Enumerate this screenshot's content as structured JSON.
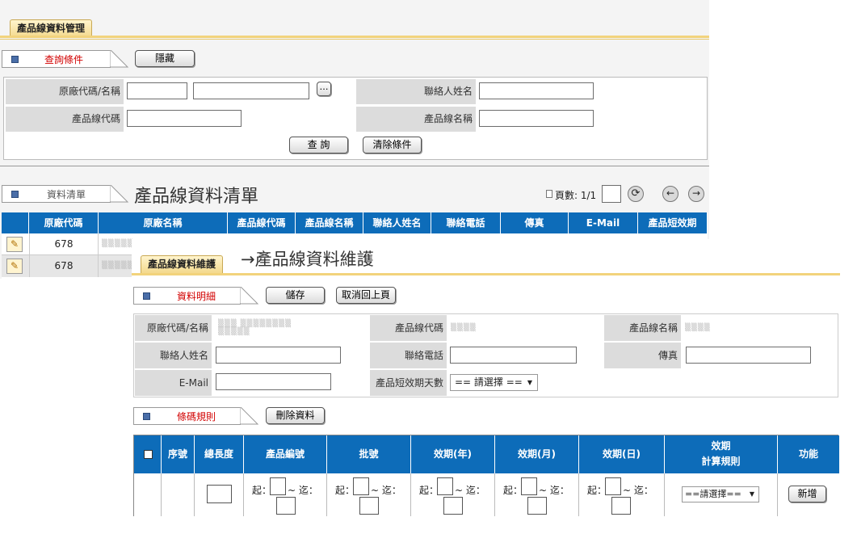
{
  "back": {
    "tab": "產品線資料管理",
    "query": {
      "section_label": "查詢條件",
      "hide_button": "隱藏",
      "fields": {
        "vendor_label": "原廠代碼/名稱",
        "contact_label": "聯絡人姓名",
        "line_code_label": "產品線代碼",
        "line_name_label": "產品線名稱",
        "browse_label": "…"
      },
      "search_button": "查 詢",
      "clear_button": "清除條件"
    },
    "list": {
      "section_label": "資料清單",
      "title": "產品線資料清單",
      "page_label": "頁數: 1/1",
      "columns": [
        "原廠代碼",
        "原廠名稱",
        "產品線代碼",
        "產品線名稱",
        "聯絡人姓名",
        "聯絡電話",
        "傳真",
        "E-Mail",
        "產品短效期"
      ],
      "rows": [
        {
          "code": "678",
          "name": ""
        },
        {
          "code": "678",
          "name": ""
        }
      ]
    }
  },
  "front": {
    "tab": "產品線資料維護",
    "title": "→產品線資料維護",
    "detail": {
      "section_label": "資料明細",
      "save_button": "儲存",
      "cancel_button": "取消回上頁",
      "vendor_label": "原廠代碼/名稱",
      "line_code_label": "產品線代碼",
      "line_name_label": "產品線名稱",
      "contact_label": "聯絡人姓名",
      "phone_label": "聯絡電話",
      "fax_label": "傳真",
      "email_label": "E-Mail",
      "short_expiry_label": "產品短效期天數",
      "short_expiry_select": "== 請選擇 =="
    },
    "barcode": {
      "section_label": "條碼規則",
      "delete_button": "刪除資料",
      "columns": [
        "序號",
        "總長度",
        "產品編號",
        "批號",
        "效期(年)",
        "效期(月)",
        "效期(日)",
        "效期\n計算規則",
        "功能"
      ],
      "from_label": "起：",
      "to_label": "~ 迄：",
      "rule_select": "==請選擇==",
      "add_button": "新增"
    }
  },
  "colors": {
    "header_blue": "#0d6cb9",
    "tab_gold": "#f2d37c",
    "section_red": "#d20000"
  },
  "icons": [
    "edit-icon",
    "refresh-icon",
    "prev-page-icon",
    "next-page-icon",
    "page-icon",
    "chevron-down-icon",
    "checkbox-icon"
  ]
}
